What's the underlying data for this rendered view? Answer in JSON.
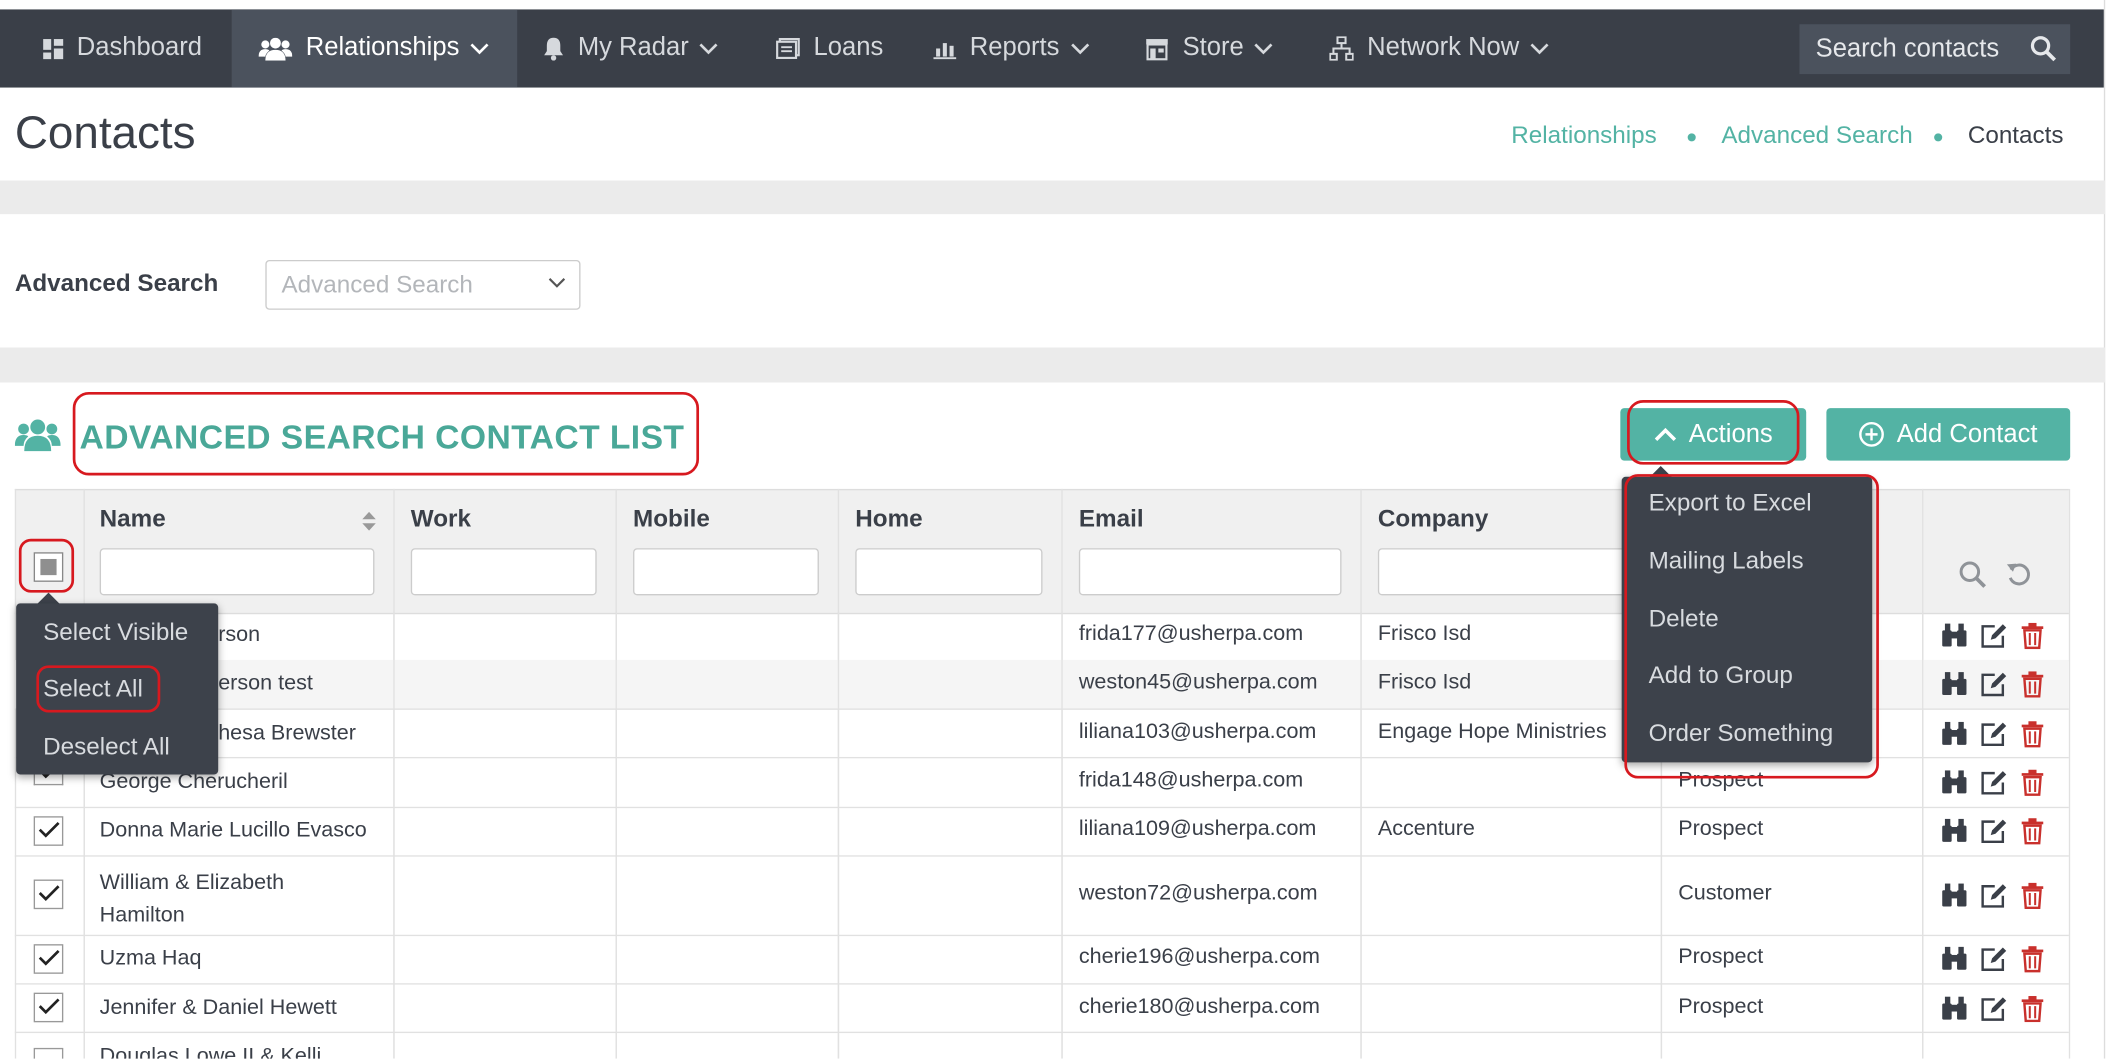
{
  "nav": {
    "items": [
      {
        "label": "Dashboard",
        "icon": "dashboard-icon"
      },
      {
        "label": "Relationships",
        "icon": "users-icon"
      },
      {
        "label": "My Radar",
        "icon": "bell-icon"
      },
      {
        "label": "Loans",
        "icon": "document-icon"
      },
      {
        "label": "Reports",
        "icon": "bar-chart-icon"
      },
      {
        "label": "Store",
        "icon": "store-icon"
      },
      {
        "label": "Network Now",
        "icon": "network-icon"
      }
    ],
    "search_placeholder": "Search contacts"
  },
  "page": {
    "title": "Contacts",
    "breadcrumb": [
      "Relationships",
      "Advanced Search",
      "Contacts"
    ]
  },
  "advanced_search": {
    "label": "Advanced Search",
    "placeholder": "Advanced Search"
  },
  "list": {
    "title": "ADVANCED SEARCH CONTACT LIST",
    "actions_label": "Actions",
    "add_contact_label": "Add Contact"
  },
  "table": {
    "columns": [
      "Name",
      "Work",
      "Mobile",
      "Home",
      "Email",
      "Company"
    ],
    "rows": [
      {
        "name": "rson",
        "email": "frida177@usherpa.com",
        "company": "Frisco Isd",
        "status": ""
      },
      {
        "name": "erson test",
        "email": "weston45@usherpa.com",
        "company": "Frisco Isd",
        "status": ""
      },
      {
        "name": "hesa Brewster",
        "email": "liliana103@usherpa.com",
        "company": "Engage Hope Ministries",
        "status": ""
      },
      {
        "name": "George Cherucheril",
        "email": "frida148@usherpa.com",
        "company": "",
        "status": "Prospect"
      },
      {
        "name": "Donna Marie Lucillo Evasco",
        "email": "liliana109@usherpa.com",
        "company": "Accenture",
        "status": "Prospect"
      },
      {
        "name": "William & Elizabeth Hamilton",
        "email": "weston72@usherpa.com",
        "company": "",
        "status": "Customer"
      },
      {
        "name": "Uzma Haq",
        "email": "cherie196@usherpa.com",
        "company": "",
        "status": "Prospect"
      },
      {
        "name": "Jennifer & Daniel Hewett",
        "email": "cherie180@usherpa.com",
        "company": "",
        "status": "Prospect"
      },
      {
        "name": "Douglas Lowe II & Kelli",
        "email": "",
        "company": "",
        "status": ""
      }
    ]
  },
  "select_menu": {
    "items": [
      "Select Visible",
      "Select All",
      "Deselect All"
    ]
  },
  "actions_menu": {
    "items": [
      "Export to Excel",
      "Mailing Labels",
      "Delete",
      "Add to Group",
      "Order Something"
    ]
  },
  "colors": {
    "nav_bg": "#3a3f48",
    "accent": "#53b3a4",
    "annotation": "#d7191f",
    "delete": "#c9302c"
  }
}
